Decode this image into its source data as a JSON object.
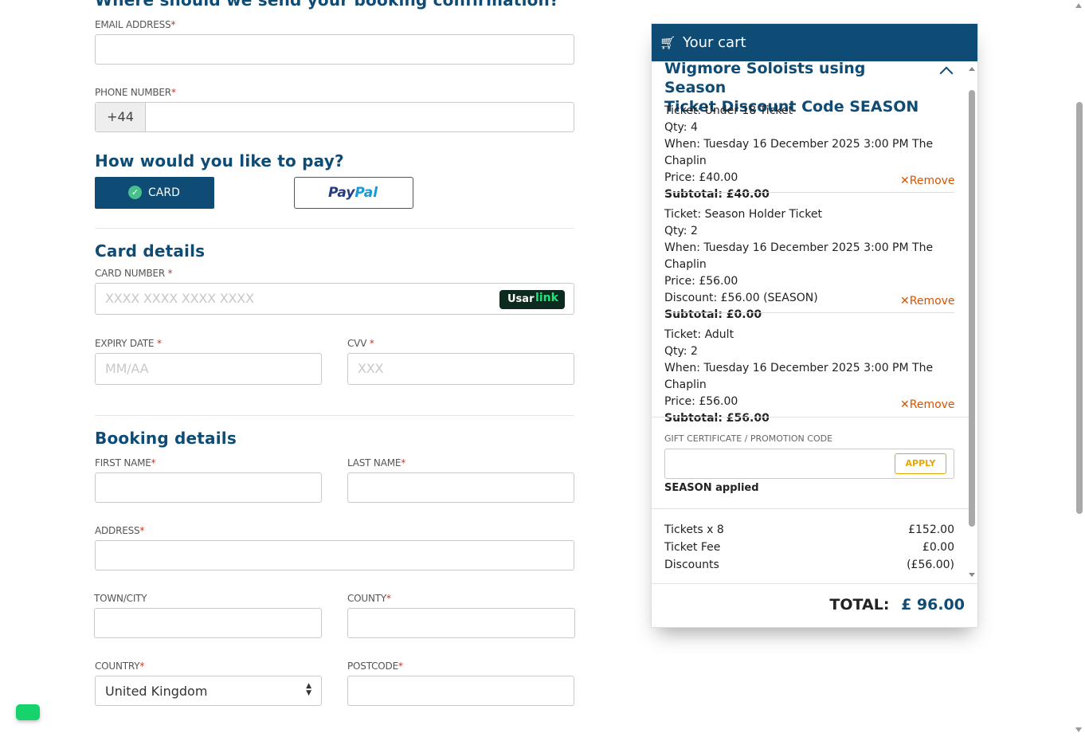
{
  "form": {
    "top_heading": "Where should we send your booking confirmation?",
    "email_label": "EMAIL ADDRESS",
    "phone_label": "PHONE NUMBER",
    "phone_prefix": "+44",
    "pay_heading": "How would you like to pay?",
    "card_button": "CARD",
    "paypal_pay": "Pay",
    "paypal_pal": "Pal",
    "card_details_heading": "Card details",
    "card_number_label": "CARD NUMBER",
    "card_number_placeholder": "XXXX XXXX XXXX XXXX",
    "usar_text": "Usar",
    "link_text": "link",
    "expiry_label": "EXPIRY DATE",
    "expiry_placeholder": "MM/AA",
    "cvv_label": "CVV",
    "cvv_placeholder": "XXX",
    "booking_heading": "Booking details",
    "first_name_label": "FIRST NAME",
    "last_name_label": "LAST NAME",
    "address_label": "ADDRESS",
    "town_label": "TOWN/CITY",
    "county_label": "COUNTY",
    "country_label": "COUNTRY",
    "country_value": "United Kingdom",
    "postcode_label": "POSTCODE",
    "required_mark": "*"
  },
  "cart": {
    "title": "Your cart",
    "event_title_line1": "Wigmore Soloists using Season",
    "event_title_line2": "Ticket Discount Code SEASON",
    "remove_label": "Remove",
    "items": [
      {
        "ticket": "Ticket: Under 18 Ticket",
        "qty": "Qty: 4",
        "when": "When: Tuesday 16 December 2025 3:00 PM The Chaplin",
        "price": "Price: £40.00",
        "subtotal": "Subtotal: £40.00"
      },
      {
        "ticket": "Ticket: Season Holder Ticket",
        "qty": "Qty: 2",
        "when": "When: Tuesday 16 December 2025 3:00 PM The Chaplin",
        "price": "Price: £56.00",
        "discount": "Discount: £56.00 (SEASON)",
        "subtotal": "Subtotal: £0.00"
      },
      {
        "ticket": "Ticket: Adult",
        "qty": "Qty: 2",
        "when": "When: Tuesday 16 December 2025 3:00 PM The Chaplin",
        "price": "Price: £56.00",
        "subtotal": "Subtotal: £56.00"
      }
    ],
    "promo_label": "GIFT CERTIFICATE / PROMOTION CODE",
    "apply_button": "APPLY",
    "promo_status": "SEASON applied",
    "summary": [
      {
        "label": "Tickets x 8",
        "value": "£152.00"
      },
      {
        "label": "Ticket Fee",
        "value": "£0.00"
      },
      {
        "label": "Discounts",
        "value": "(£56.00)"
      }
    ],
    "total_label": "TOTAL:",
    "total_value": "£ 96.00"
  },
  "colors": {
    "brand": "#0f4c75",
    "remove": "#d35400",
    "apply": "#e6a700",
    "chat_widget": "#17d36b"
  }
}
